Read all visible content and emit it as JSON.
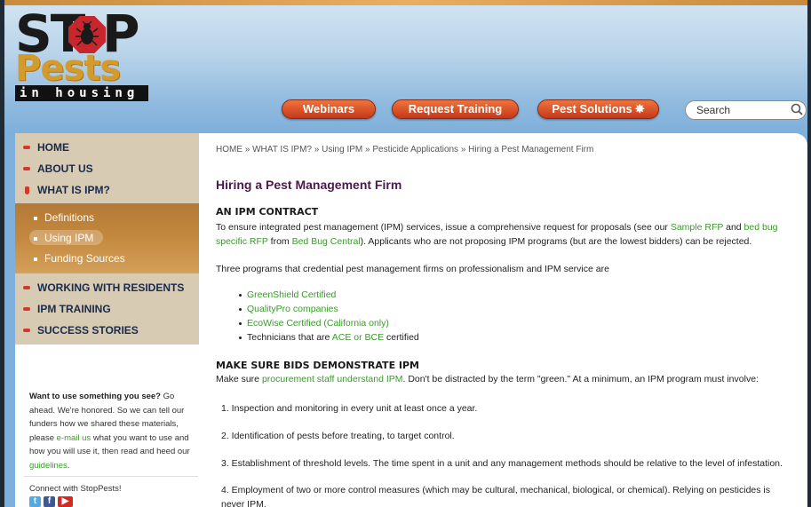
{
  "logo": {
    "stop_left": "ST",
    "stop_right": "P",
    "pests": "Pests",
    "tagline": "in housing"
  },
  "nav": {
    "webinars": "Webinars",
    "request_training": "Request Training",
    "pest_solutions": "Pest Solutions",
    "search_placeholder": "Search"
  },
  "sidebar": {
    "items": [
      {
        "label": "HOME"
      },
      {
        "label": "ABOUT US"
      },
      {
        "label": "WHAT IS IPM?"
      }
    ],
    "subitems": [
      {
        "label": "Definitions"
      },
      {
        "label": "Using IPM"
      },
      {
        "label": "Funding Sources"
      }
    ],
    "items2": [
      {
        "label": "WORKING WITH RESIDENTS"
      },
      {
        "label": "IPM TRAINING"
      },
      {
        "label": "SUCCESS STORIES"
      }
    ],
    "want": {
      "bold": "Want to use something you see?",
      "t1": " Go ahead. We're honored. So we can tell our funders how we shared these materials, please ",
      "link1": "e-mail us",
      "t2": " what you want to use and how you will use it, then read and heed our ",
      "link2": "guidelines",
      "t3": "."
    },
    "connect": "Connect with StopPests!"
  },
  "main": {
    "breadcrumb": "HOME » WHAT IS IPM? » Using IPM » Pesticide Applications » Hiring a Pest Management Firm",
    "title": "Hiring a Pest Management Firm",
    "contract_heading": "AN IPM CONTRACT",
    "contract": {
      "t1": "To ensure integrated pest management (IPM) services, issue a comprehensive request for proposals (see our ",
      "link1": "Sample RFP",
      "t2": " and ",
      "link2": "bed bug specific RFP",
      "t3": " from ",
      "link3": "Bed Bug Central",
      "t4": "). Applicants who are not proposing IPM programs (but are the lowest bidders) can be rejected."
    },
    "three_programs": "Three programs that credential pest management firms on professionalism and IPM service are",
    "credentials": [
      {
        "link": "GreenShield Certified"
      },
      {
        "link": "QualityPro companies"
      },
      {
        "link": "EcoWise Certified (California only)"
      }
    ],
    "technicians": {
      "t1": "Technicians that are ",
      "link": "ACE or BCE",
      "t2": " certified"
    },
    "bids_heading": "MAKE SURE BIDS DEMONSTRATE IPM",
    "bids": {
      "t1": "Make sure ",
      "link": "procurement staff understand IPM",
      "t2": ". Don't be distracted by the term \"green.\" At a minimum, an IPM program must involve:"
    },
    "steps": [
      "1. Inspection and monitoring in every unit at least once a year.",
      "2. Identification of pests before treating, to target control.",
      "3. Establishment of threshold levels. The time spent in a unit and any management methods should be relative to the level of infestation.",
      "4. Employment of two or more control measures (which may be cultural, mechanical, biological, or chemical). Relying on pesticides is never IPM."
    ]
  }
}
